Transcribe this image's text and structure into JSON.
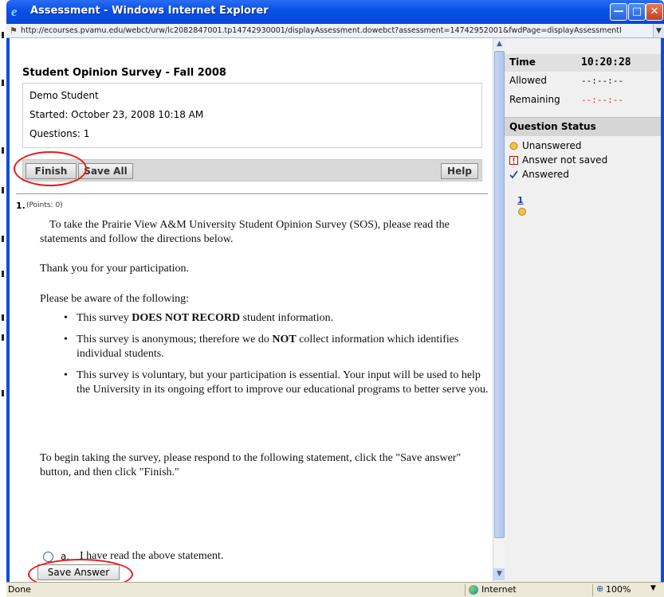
{
  "window": {
    "title": "Assessment - Windows Internet Explorer",
    "url": "http://ecourses.pvamu.edu/webct/urw/lc2082847001.tp14742930001/displayAssessment.dowebct?assessment=14742952001&fwdPage=displayAssessmentI"
  },
  "survey": {
    "title": "Student Opinion Survey - Fall 2008",
    "student": "Demo Student",
    "started": "Started: October 23, 2008 10:18 AM",
    "questions": "Questions: 1"
  },
  "buttons": {
    "finish": "Finish",
    "save_all": "Save All",
    "help": "Help",
    "save_answer": "Save Answer"
  },
  "question": {
    "number": "1.",
    "points": "(Points: 0)",
    "intro": "To take the Prairie View A&M University Student Opinion Survey (SOS), please read the statements and follow the directions below.",
    "thanks": "Thank you for your participation.",
    "aware": "Please be aware of the following:",
    "bullets": [
      {
        "pre": "This survey ",
        "bold": "DOES NOT RECORD",
        "post": " student information."
      },
      {
        "pre": "This survey is anonymous; therefore we do ",
        "bold": "NOT",
        "post": " collect information which identifies individual students."
      },
      {
        "pre": "This survey is voluntary, but your participation is essential. Your input will be used to help the University in its ongoing effort to improve our educational programs to better serve you.",
        "bold": "",
        "post": ""
      }
    ],
    "instruction": "To begin taking the survey, please respond to the following statement, click the \"Save answer\" button, and then click \"Finish.\"",
    "option_letter": "a.",
    "option_text": "I have read the above statement."
  },
  "timer": {
    "label": "Time",
    "value": "10:20:28",
    "allowed_label": "Allowed",
    "allowed_value": "--:--:--",
    "remaining_label": "Remaining",
    "remaining_value": "--:--:--"
  },
  "status_panel": {
    "header": "Question Status",
    "legend": [
      {
        "icon": "unanswered-circle-icon",
        "label": "Unanswered"
      },
      {
        "icon": "not-saved-icon",
        "label": "Answer not saved"
      },
      {
        "icon": "checkmark-icon",
        "label": "Answered"
      }
    ],
    "question_link": "1"
  },
  "statusbar": {
    "left": "Done",
    "zone": "Internet",
    "zoom": "100%"
  },
  "colors": {
    "title_bar": "#0a52e8",
    "highlight_ring": "#e8191b",
    "remaining_value": "#e8191b",
    "link": "#1a3c9c"
  }
}
